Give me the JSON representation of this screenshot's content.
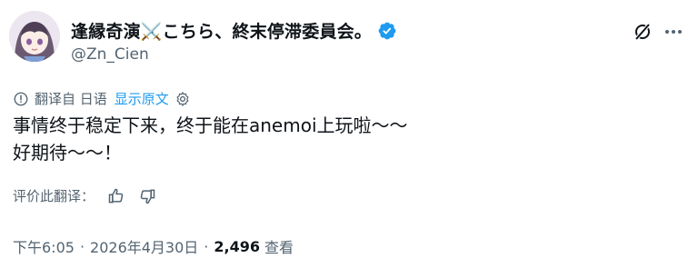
{
  "author": {
    "display_name": "逢縁奇演⚔️こちら、終末停滞委員会。",
    "handle": "@Zn_Cien"
  },
  "translation": {
    "label": "翻译自 日语",
    "show_original": "显示原文"
  },
  "tweet": {
    "line1": "事情终于稳定下来，终于能在anemoi上玩啦～～",
    "line2": "好期待～～！"
  },
  "rating": {
    "label": "评价此翻译："
  },
  "meta": {
    "time": "下午6:05",
    "date": "2026年4月30日",
    "views": "2,496",
    "views_label": "查看"
  },
  "colors": {
    "accent": "#1d9bf0",
    "secondary_text": "#536471",
    "primary_text": "#0f1419"
  },
  "icons": [
    "verified-badge-icon",
    "grok-icon",
    "more-icon",
    "translate-icon",
    "settings-icon",
    "thumbs-up-icon",
    "thumbs-down-icon"
  ]
}
